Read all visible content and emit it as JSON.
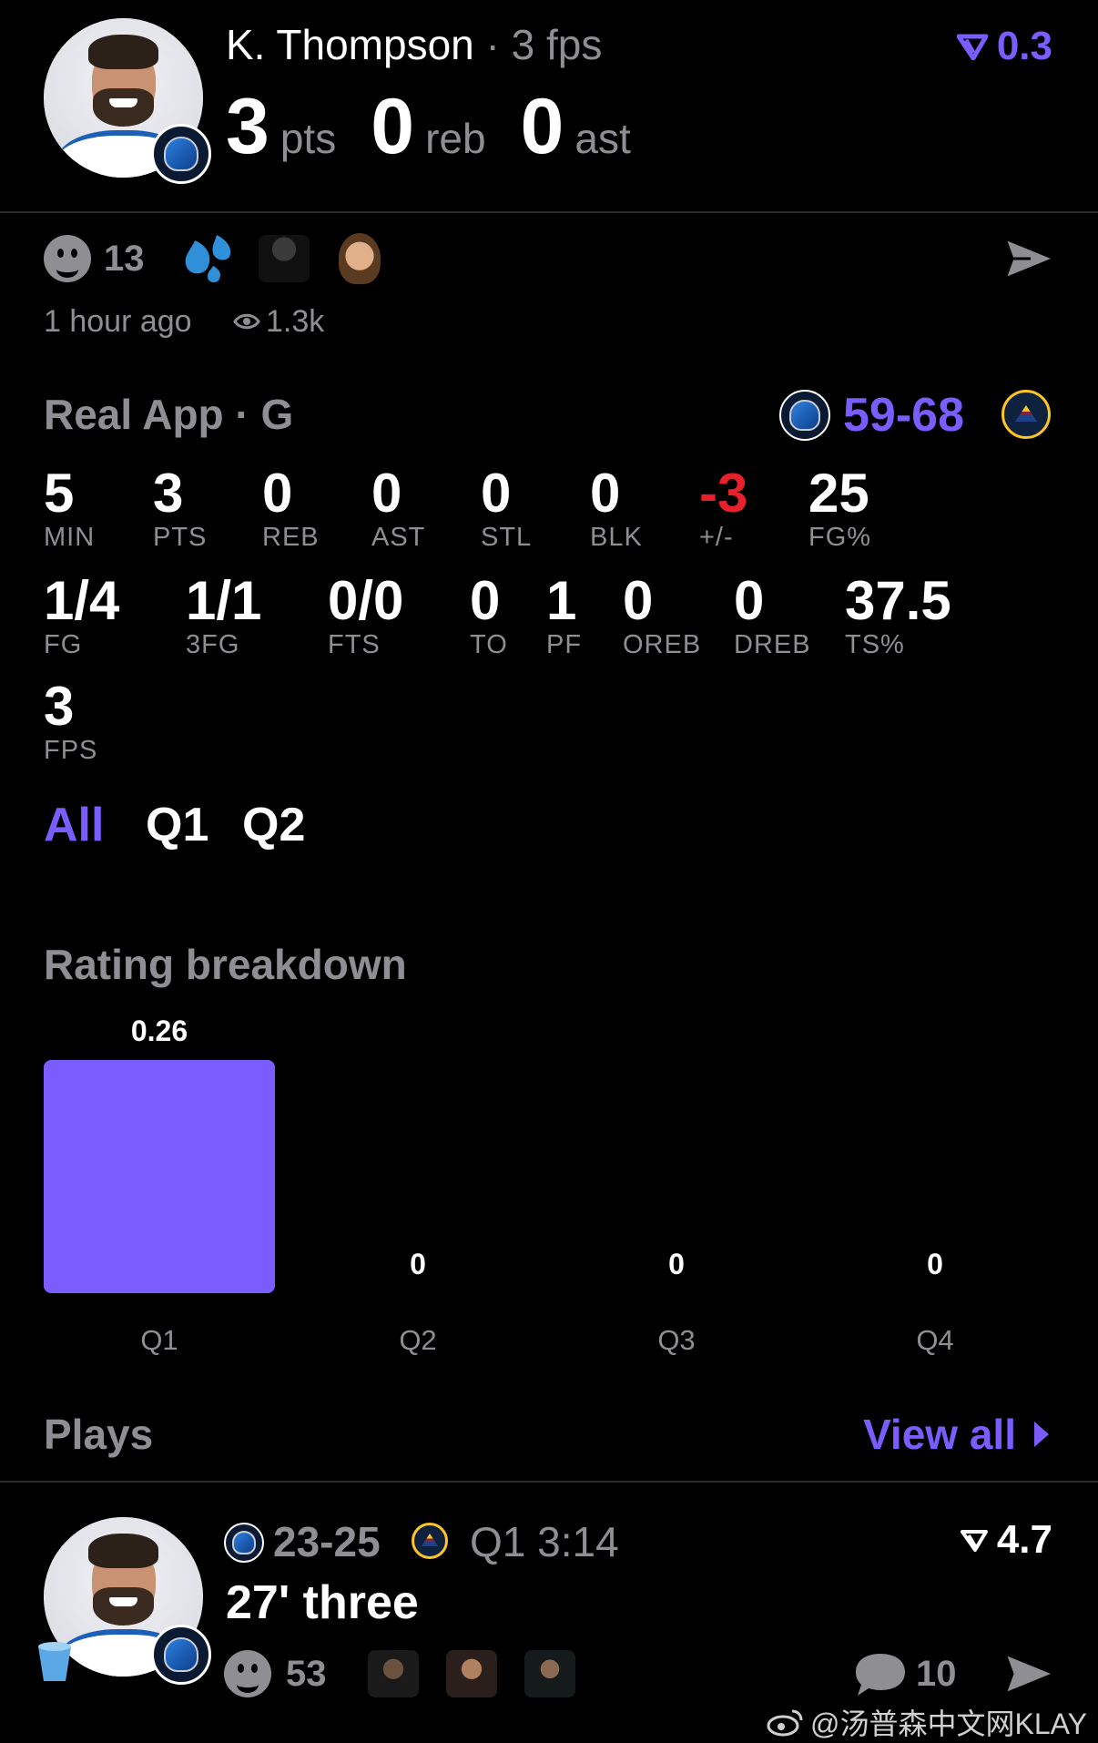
{
  "header": {
    "player_name": "K. Thompson",
    "fps_text": "3 fps",
    "rating_change": "0.3",
    "pts": "3",
    "pts_label": "pts",
    "reb": "0",
    "reb_label": "reb",
    "ast": "0",
    "ast_label": "ast"
  },
  "social": {
    "reaction_count": "13",
    "time_ago": "1 hour ago",
    "views": "1.3k"
  },
  "game": {
    "source": "Real App · G",
    "score": "59-68"
  },
  "stats_row1": [
    {
      "value": "5",
      "label": "MIN"
    },
    {
      "value": "3",
      "label": "PTS"
    },
    {
      "value": "0",
      "label": "REB"
    },
    {
      "value": "0",
      "label": "AST"
    },
    {
      "value": "0",
      "label": "STL"
    },
    {
      "value": "0",
      "label": "BLK"
    },
    {
      "value": "-3",
      "label": "+/-"
    },
    {
      "value": "25",
      "label": "FG%"
    }
  ],
  "stats_row2": [
    {
      "value": "1/4",
      "label": "FG"
    },
    {
      "value": "1/1",
      "label": "3FG"
    },
    {
      "value": "0/0",
      "label": "FTS"
    },
    {
      "value": "0",
      "label": "TO"
    },
    {
      "value": "1",
      "label": "PF"
    },
    {
      "value": "0",
      "label": "OREB"
    },
    {
      "value": "0",
      "label": "DREB"
    },
    {
      "value": "37.5",
      "label": "TS%"
    }
  ],
  "stats_row3": [
    {
      "value": "3",
      "label": "FPS"
    }
  ],
  "period_tabs": [
    "All",
    "Q1",
    "Q2"
  ],
  "rating_section_title": "Rating breakdown",
  "chart_data": {
    "type": "bar",
    "title": "Rating breakdown",
    "categories": [
      "Q1",
      "Q2",
      "Q3",
      "Q4"
    ],
    "values": [
      0.26,
      0,
      0,
      0
    ],
    "value_labels": [
      "0.26",
      "0",
      "0",
      "0"
    ],
    "bar_color": "#7B5CFF"
  },
  "plays": {
    "title": "Plays",
    "view_all": "View all",
    "item": {
      "score": "23-25",
      "clock": "Q1 3:14",
      "description": "27' three",
      "rating": "4.7",
      "reaction_count": "53",
      "comment_count": "10"
    }
  },
  "watermark": "@汤普森中文网KLAY",
  "colors": {
    "accent": "#7B5CFF",
    "negative": "#E8202A",
    "muted": "#8e8e93"
  }
}
